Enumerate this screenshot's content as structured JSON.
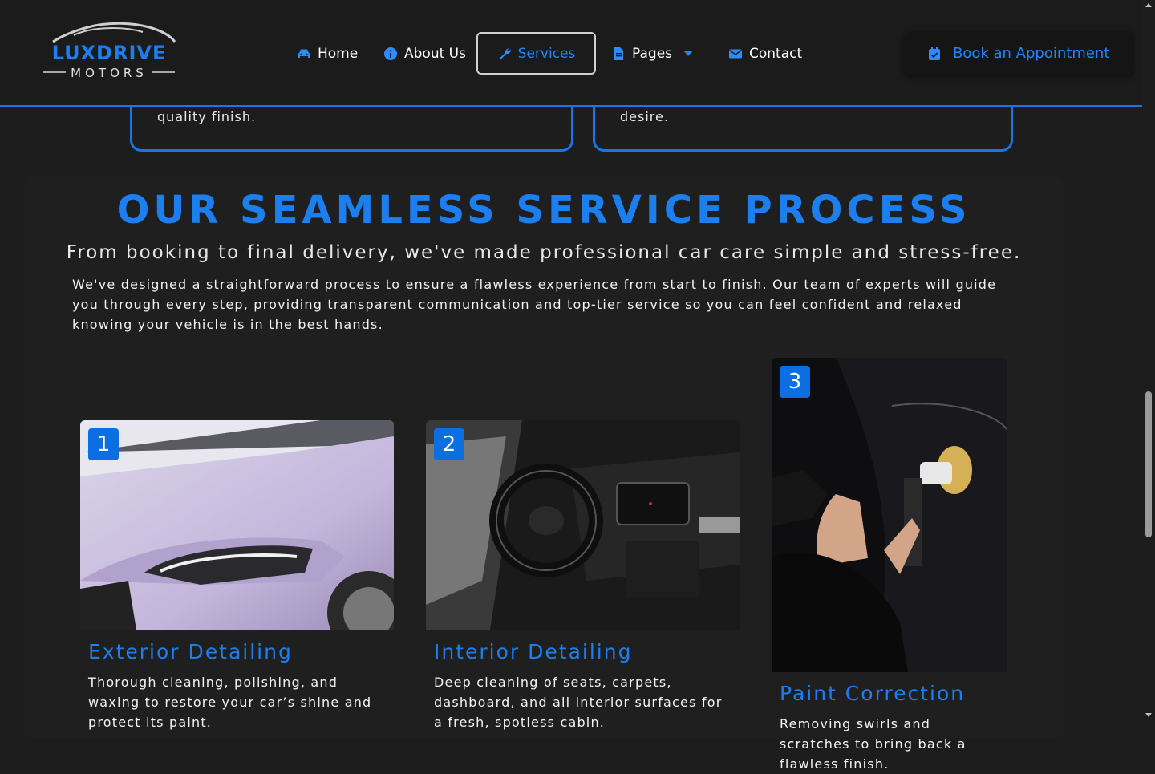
{
  "brand": {
    "name": "LUXDRIVE",
    "tagline": "MOTORS"
  },
  "nav": {
    "items": [
      {
        "label": "Home",
        "icon": "car-icon"
      },
      {
        "label": "About Us",
        "icon": "info-icon"
      },
      {
        "label": "Services",
        "icon": "wrench-icon",
        "active": true
      },
      {
        "label": "Pages",
        "icon": "file-icon",
        "dropdown": true
      },
      {
        "label": "Contact",
        "icon": "envelope-icon"
      }
    ],
    "cta_label": "Book an Appointment"
  },
  "feature_cards": [
    {
      "text": "quality finish."
    },
    {
      "text": "desire."
    }
  ],
  "process": {
    "title": "OUR SEAMLESS SERVICE PROCESS",
    "subtitle": "From booking to final delivery, we've made professional car care simple and stress-free.",
    "description": "We've designed a straightforward process to ensure a flawless experience from start to finish. Our team of experts will guide you through every step, providing transparent communication and top-tier service so you can feel confident and relaxed knowing your vehicle is in the best hands.",
    "steps": [
      {
        "number": "1",
        "title": "Exterior Detailing",
        "text": "Thorough cleaning, polishing, and waxing to restore your car’s shine and protect its paint."
      },
      {
        "number": "2",
        "title": "Interior Detailing",
        "text": "Deep cleaning of seats, carpets, dashboard, and all interior surfaces for a fresh, spotless cabin."
      },
      {
        "number": "3",
        "title": "Paint Correction",
        "text": "Removing swirls and scratches to bring back a flawless finish."
      }
    ]
  },
  "colors": {
    "accent": "#1b7ff0",
    "background": "#1d1d1d",
    "header_border": "#1976e8"
  }
}
